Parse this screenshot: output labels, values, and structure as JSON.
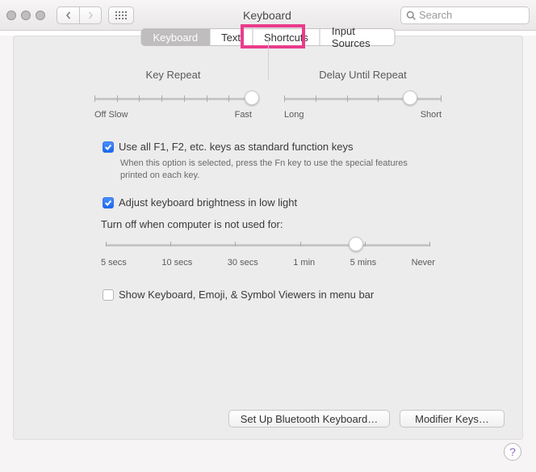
{
  "window": {
    "title": "Keyboard"
  },
  "toolbar": {
    "search_placeholder": "Search"
  },
  "tabs": {
    "items": [
      {
        "label": "Keyboard",
        "selected": true
      },
      {
        "label": "Text"
      },
      {
        "label": "Shortcuts",
        "highlighted": true
      },
      {
        "label": "Input Sources"
      }
    ]
  },
  "sliders": {
    "key_repeat": {
      "title": "Key Repeat",
      "left_label": "Off",
      "left_label2": "Slow",
      "right_label": "Fast",
      "ticks": 8,
      "value_pct": 100
    },
    "delay": {
      "title": "Delay Until Repeat",
      "left_label": "Long",
      "right_label": "Short",
      "ticks": 6,
      "value_pct": 80
    },
    "turnoff": {
      "label": "Turn off when computer is not used for:",
      "stops": [
        "5 secs",
        "10 secs",
        "30 secs",
        "1 min",
        "5 mins",
        "Never"
      ],
      "value_pct": 75
    }
  },
  "options": {
    "fn_keys": {
      "label": "Use all F1, F2, etc. keys as standard function keys",
      "checked": true,
      "sub": "When this option is selected, press the Fn key to use the special features printed on each key."
    },
    "brightness": {
      "label": "Adjust keyboard brightness in low light",
      "checked": true
    },
    "menubar": {
      "label": "Show Keyboard, Emoji, & Symbol Viewers in menu bar",
      "checked": false
    }
  },
  "buttons": {
    "bluetooth": "Set Up Bluetooth Keyboard…",
    "modifier": "Modifier Keys…"
  }
}
